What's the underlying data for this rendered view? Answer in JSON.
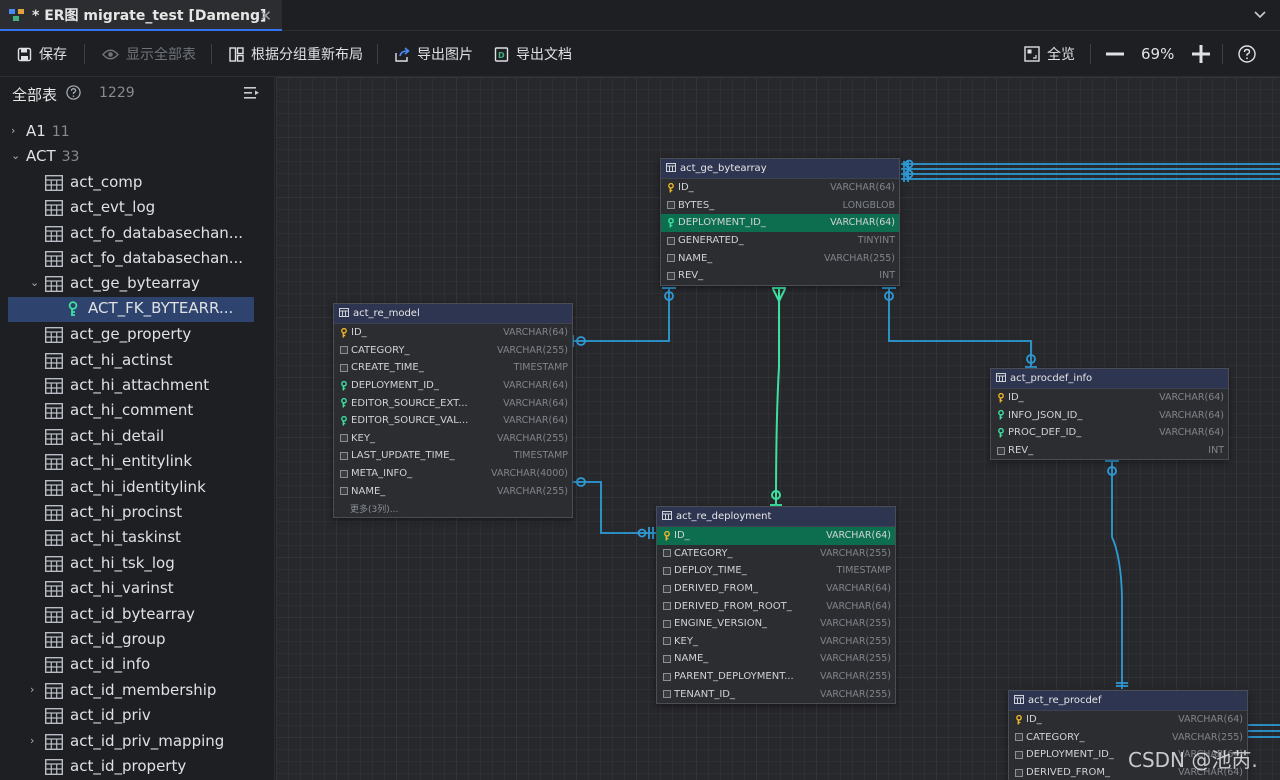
{
  "tab": {
    "title": "* ER图 migrate_test [Dameng]"
  },
  "toolbar": {
    "save": "保存",
    "show_all": "显示全部表",
    "relayout": "根据分组重新布局",
    "export_image": "导出图片",
    "export_doc": "导出文档",
    "overview": "全览",
    "zoom": "69%"
  },
  "sidebar": {
    "title": "全部表",
    "count": "1229",
    "groups": [
      {
        "name": "A1",
        "count": "11"
      },
      {
        "name": "ACT",
        "count": "33"
      }
    ],
    "items": [
      "act_comp",
      "act_evt_log",
      "act_fo_databasechan...",
      "act_fo_databasechan...",
      "act_ge_bytearray",
      "ACT_FK_BYTEARR...",
      "act_ge_property",
      "act_hi_actinst",
      "act_hi_attachment",
      "act_hi_comment",
      "act_hi_detail",
      "act_hi_entitylink",
      "act_hi_identitylink",
      "act_hi_procinst",
      "act_hi_taskinst",
      "act_hi_tsk_log",
      "act_hi_varinst",
      "act_id_bytearray",
      "act_id_group",
      "act_id_info",
      "act_id_membership",
      "act_id_priv",
      "act_id_priv_mapping",
      "act_id_property"
    ]
  },
  "tables": {
    "bytearray": {
      "name": "act_ge_bytearray",
      "cols": [
        {
          "n": "ID_",
          "t": "VARCHAR(64)"
        },
        {
          "n": "BYTES_",
          "t": "LONGBLOB"
        },
        {
          "n": "DEPLOYMENT_ID_",
          "t": "VARCHAR(64)"
        },
        {
          "n": "GENERATED_",
          "t": "TINYINT"
        },
        {
          "n": "NAME_",
          "t": "VARCHAR(255)"
        },
        {
          "n": "REV_",
          "t": "INT"
        }
      ]
    },
    "model": {
      "name": "act_re_model",
      "cols": [
        {
          "n": "ID_",
          "t": "VARCHAR(64)"
        },
        {
          "n": "CATEGORY_",
          "t": "VARCHAR(255)"
        },
        {
          "n": "CREATE_TIME_",
          "t": "TIMESTAMP"
        },
        {
          "n": "DEPLOYMENT_ID_",
          "t": "VARCHAR(64)"
        },
        {
          "n": "EDITOR_SOURCE_EXT...",
          "t": "VARCHAR(64)"
        },
        {
          "n": "EDITOR_SOURCE_VAL...",
          "t": "VARCHAR(64)"
        },
        {
          "n": "KEY_",
          "t": "VARCHAR(255)"
        },
        {
          "n": "LAST_UPDATE_TIME_",
          "t": "TIMESTAMP"
        },
        {
          "n": "META_INFO_",
          "t": "VARCHAR(4000)"
        },
        {
          "n": "NAME_",
          "t": "VARCHAR(255)"
        }
      ],
      "more": "更多(3列)..."
    },
    "procdef_info": {
      "name": "act_procdef_info",
      "cols": [
        {
          "n": "ID_",
          "t": "VARCHAR(64)"
        },
        {
          "n": "INFO_JSON_ID_",
          "t": "VARCHAR(64)"
        },
        {
          "n": "PROC_DEF_ID_",
          "t": "VARCHAR(64)"
        },
        {
          "n": "REV_",
          "t": "INT"
        }
      ]
    },
    "deployment": {
      "name": "act_re_deployment",
      "cols": [
        {
          "n": "ID_",
          "t": "VARCHAR(64)"
        },
        {
          "n": "CATEGORY_",
          "t": "VARCHAR(255)"
        },
        {
          "n": "DEPLOY_TIME_",
          "t": "TIMESTAMP"
        },
        {
          "n": "DERIVED_FROM_",
          "t": "VARCHAR(64)"
        },
        {
          "n": "DERIVED_FROM_ROOT_",
          "t": "VARCHAR(64)"
        },
        {
          "n": "ENGINE_VERSION_",
          "t": "VARCHAR(255)"
        },
        {
          "n": "KEY_",
          "t": "VARCHAR(255)"
        },
        {
          "n": "NAME_",
          "t": "VARCHAR(255)"
        },
        {
          "n": "PARENT_DEPLOYMENT...",
          "t": "VARCHAR(255)"
        },
        {
          "n": "TENANT_ID_",
          "t": "VARCHAR(255)"
        }
      ]
    },
    "procdef": {
      "name": "act_re_procdef",
      "cols": [
        {
          "n": "ID_",
          "t": "VARCHAR(64)"
        },
        {
          "n": "CATEGORY_",
          "t": "VARCHAR(255)"
        },
        {
          "n": "DEPLOYMENT_ID_",
          "t": "VARCHAR(64)"
        },
        {
          "n": "DERIVED_FROM_",
          "t": "VARCHAR(64)"
        }
      ]
    }
  },
  "watermark": "CSDN @池芮."
}
